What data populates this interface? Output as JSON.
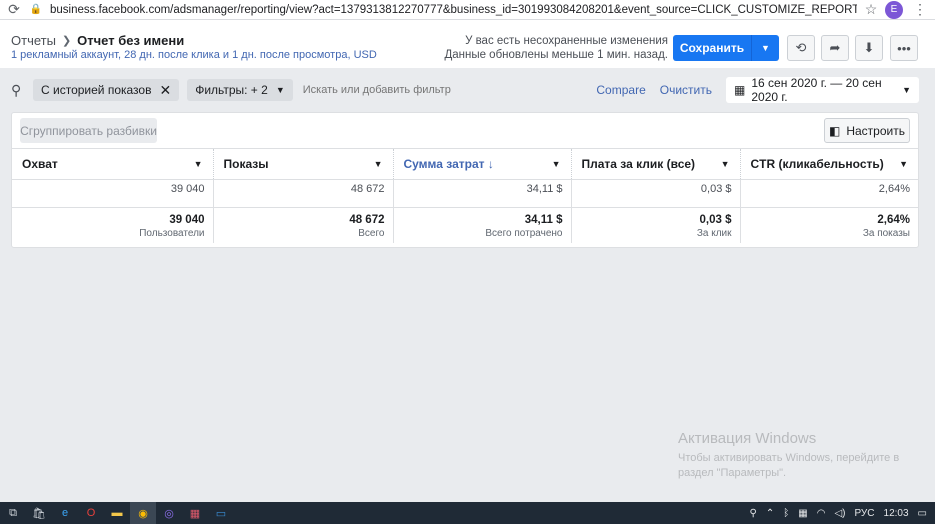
{
  "browser": {
    "url": "business.facebook.com/adsmanager/reporting/view?act=1379313812270777&business_id=301993084208201&event_source=CLICK_CUSTOMIZE_REPORT&breakdowns=&locke…",
    "profile_initial": "E"
  },
  "header": {
    "breadcrumb_parent": "Отчеты",
    "title": "Отчет без имени",
    "subtitle": "1 рекламный аккаунт, 28 дн. после клика и 1 дн. после просмотра, USD",
    "unsaved_line1": "У вас есть несохраненные изменения",
    "unsaved_line2": "Данные обновлены меньше 1 мин. назад.",
    "save_label": "Сохранить"
  },
  "filters": {
    "chip_history": "С историей показов",
    "chip_filters": "Фильтры: + 2",
    "search_placeholder": "Искать или добавить фильтр",
    "compare": "Compare",
    "clear": "Очистить",
    "date_range": "16 сен 2020 г. — 20 сен 2020 г."
  },
  "table": {
    "group_button": "Сгруппировать разбивки",
    "setup_button": "Настроить",
    "columns": [
      {
        "label": "Охват",
        "sorted": false
      },
      {
        "label": "Показы",
        "sorted": false
      },
      {
        "label": "Сумма затрат ↓",
        "sorted": true
      },
      {
        "label": "Плата за клик (все)",
        "sorted": false
      },
      {
        "label": "CTR (кликабельность)",
        "sorted": false
      }
    ],
    "row": [
      "39 040",
      "48 672",
      "34,11 $",
      "0,03 $",
      "2,64%"
    ],
    "totals": [
      {
        "value": "39 040",
        "sub": "Пользователи"
      },
      {
        "value": "48 672",
        "sub": "Всего"
      },
      {
        "value": "34,11 $",
        "sub": "Всего потрачено"
      },
      {
        "value": "0,03 $",
        "sub": "За клик"
      },
      {
        "value": "2,64%",
        "sub": "За показы"
      }
    ]
  },
  "watermark": {
    "line1": "Активация Windows",
    "line2": "Чтобы активировать Windows, перейдите в",
    "line3": "раздел \"Параметры\"."
  },
  "taskbar": {
    "lang": "РУС",
    "time": "12:03"
  }
}
